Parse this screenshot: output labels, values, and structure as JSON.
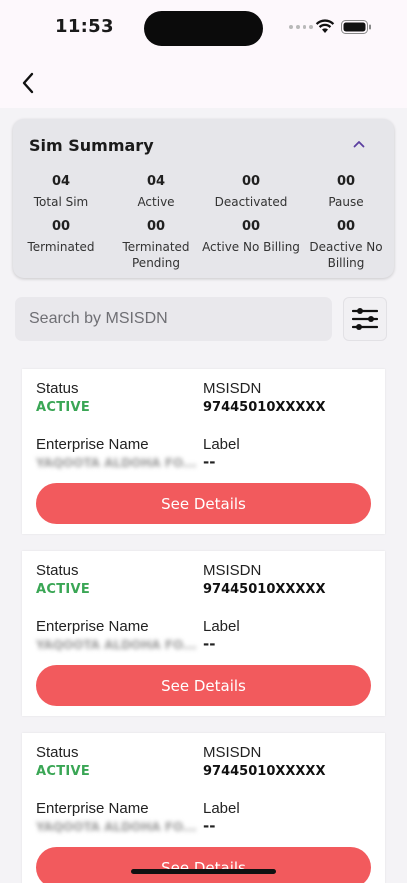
{
  "status_bar": {
    "time": "11:53"
  },
  "summary": {
    "title": "Sim Summary",
    "stats": [
      {
        "value": "04",
        "label": "Total Sim"
      },
      {
        "value": "04",
        "label": "Active"
      },
      {
        "value": "00",
        "label": "Deactivated"
      },
      {
        "value": "00",
        "label": "Pause"
      },
      {
        "value": "00",
        "label": "Terminated"
      },
      {
        "value": "00",
        "label": "Terminated Pending"
      },
      {
        "value": "00",
        "label": "Active No Billing"
      },
      {
        "value": "00",
        "label": "Deactive No Billing"
      }
    ]
  },
  "search": {
    "placeholder": "Search by MSISDN"
  },
  "cards": [
    {
      "status_label": "Status",
      "status": "ACTIVE",
      "msisdn_label": "MSISDN",
      "msisdn": "97445010XXXXX",
      "enterprise_label": "Enterprise Name",
      "enterprise": "YAQOOTA ALDOHA FO...",
      "label_label": "Label",
      "label": "--",
      "button": "See Details"
    },
    {
      "status_label": "Status",
      "status": "ACTIVE",
      "msisdn_label": "MSISDN",
      "msisdn": "97445010XXXXX",
      "enterprise_label": "Enterprise Name",
      "enterprise": "YAQOOTA ALDOHA FO...",
      "label_label": "Label",
      "label": "--",
      "button": "See Details"
    },
    {
      "status_label": "Status",
      "status": "ACTIVE",
      "msisdn_label": "MSISDN",
      "msisdn": "97445010XXXXX",
      "enterprise_label": "Enterprise Name",
      "enterprise": "YAQOOTA ALDOHA FO...",
      "label_label": "Label",
      "label": "--",
      "button": "See Details"
    }
  ],
  "colors": {
    "accent_button": "#f25a5d",
    "status_active": "#3aa655",
    "chevron": "#5b3fa0"
  },
  "icons": [
    "back-arrow-icon",
    "chevron-up-icon",
    "filter-sliders-icon",
    "wifi-icon",
    "battery-icon"
  ]
}
